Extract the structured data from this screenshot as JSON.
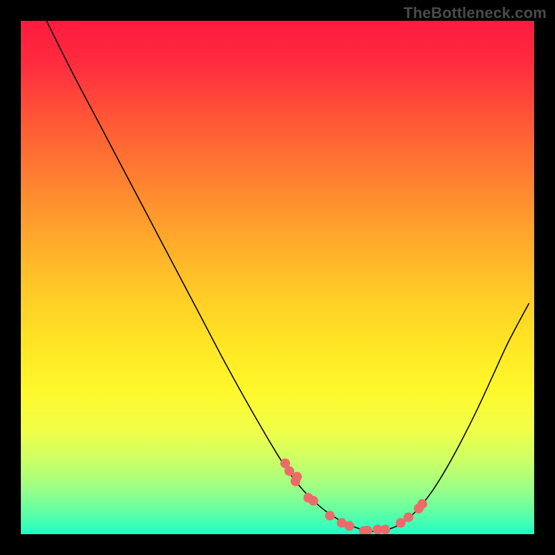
{
  "watermark": "TheBottleneck.com",
  "chart_data": {
    "type": "line",
    "title": "",
    "xlabel": "",
    "ylabel": "",
    "xlim": [
      0,
      100
    ],
    "ylim": [
      0,
      100
    ],
    "background": {
      "type": "vertical-gradient",
      "stops": [
        {
          "t": 0.0,
          "color": "#ff1a3f"
        },
        {
          "t": 0.08,
          "color": "#ff2b3e"
        },
        {
          "t": 0.2,
          "color": "#ff5a36"
        },
        {
          "t": 0.35,
          "color": "#ff8f2f"
        },
        {
          "t": 0.5,
          "color": "#ffc228"
        },
        {
          "t": 0.62,
          "color": "#ffe324"
        },
        {
          "t": 0.72,
          "color": "#fff82b"
        },
        {
          "t": 0.8,
          "color": "#f0ff4a"
        },
        {
          "t": 0.86,
          "color": "#c9ff68"
        },
        {
          "t": 0.91,
          "color": "#9cff85"
        },
        {
          "t": 0.95,
          "color": "#6affa0"
        },
        {
          "t": 0.98,
          "color": "#3fffb6"
        },
        {
          "t": 1.0,
          "color": "#1effc4"
        }
      ]
    },
    "series": [
      {
        "name": "bottleneck-curve",
        "stroke": "#000000",
        "strokeWidth": 1.6,
        "x": [
          5,
          10,
          15,
          20,
          25,
          30,
          35,
          40,
          45,
          50,
          53,
          56,
          59,
          62,
          65,
          68,
          71,
          74,
          77,
          80,
          83,
          86,
          89,
          92,
          95,
          99
        ],
        "values": [
          100,
          90,
          80.5,
          71,
          61.5,
          52,
          42.5,
          33,
          24,
          15.5,
          11,
          7.5,
          4.8,
          2.8,
          1.4,
          0.6,
          0.8,
          2.0,
          4.5,
          8.2,
          13,
          18.5,
          24.5,
          31,
          37.5,
          45
        ]
      }
    ],
    "points": {
      "name": "highlighted-points",
      "fill": "#ed6a6a",
      "radius": 7,
      "x": [
        51.5,
        52.3,
        53.5,
        53.8,
        56.0,
        57.0,
        60.2,
        62.5,
        64.0,
        66.8,
        67.5,
        69.5,
        71.0,
        74.0,
        75.5,
        77.5,
        78.2
      ],
      "values": [
        13.8,
        12.3,
        10.3,
        11.2,
        7.1,
        6.5,
        3.6,
        2.2,
        1.6,
        0.6,
        0.7,
        0.9,
        0.9,
        2.2,
        3.3,
        5.0,
        5.9
      ]
    }
  }
}
